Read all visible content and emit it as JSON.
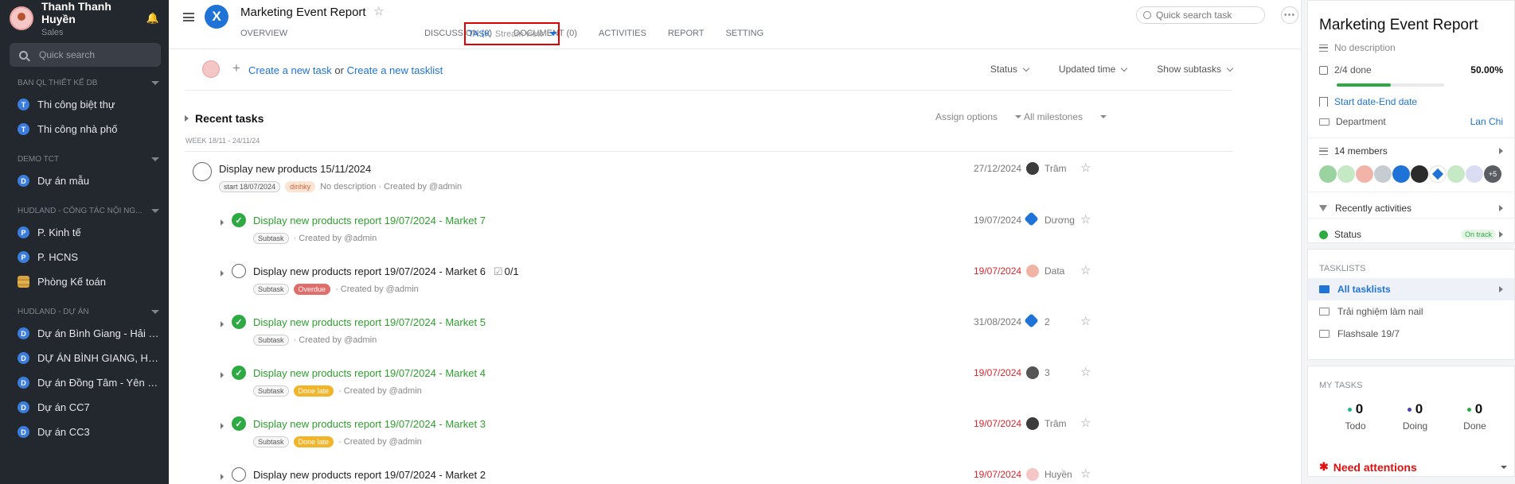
{
  "user": {
    "name": "Thanh Thanh Huyền",
    "role": "Sales"
  },
  "sidebar": {
    "search_placeholder": "Quick search",
    "groups": [
      {
        "title": "BAN QL THIẾT KẾ DB",
        "items": [
          {
            "badge": "T",
            "label": "Thi công biệt thự"
          },
          {
            "badge": "T",
            "label": "Thi công nhà phố"
          }
        ]
      },
      {
        "title": "DEMO TCT",
        "items": [
          {
            "badge": "D",
            "label": "Dự án mẫu"
          }
        ]
      },
      {
        "title": "HUDLAND - CÔNG TÁC NỘI NG...",
        "items": [
          {
            "badge": "P",
            "label": "P. Kinh tế"
          },
          {
            "badge": "P",
            "label": "P. HCNS"
          },
          {
            "badge": "",
            "label": "Phòng Kế toán"
          }
        ]
      },
      {
        "title": "HUDLAND - DỰ ÁN",
        "items": [
          {
            "badge": "D",
            "label": "Dự án Bình Giang - Hải D..."
          },
          {
            "badge": "D",
            "label": "DỰ ÁN BÌNH GIANG, HẢI ..."
          },
          {
            "badge": "D",
            "label": "Dự án Đồng Tâm - Yên Bái"
          },
          {
            "badge": "D",
            "label": "Dự án CC7"
          },
          {
            "badge": "D",
            "label": "Dự án CC3"
          }
        ]
      }
    ]
  },
  "header": {
    "title": "Marketing Event Report",
    "logo_letter": "X",
    "tabs": {
      "overview": "OVERVIEW",
      "task": "TASK",
      "stream_view": "Stream view",
      "discussion": "DISCUSSION (0)",
      "document": "DOCUMENT (0)",
      "activities": "ACTIVITIES",
      "report": "REPORT",
      "setting": "SETTING"
    },
    "search_placeholder": "Quick search task"
  },
  "create": {
    "create_task": "Create a new task",
    "or": " or ",
    "create_tasklist": "Create a new tasklist"
  },
  "filters": {
    "status": "Status",
    "updated": "Updated time",
    "subtasks": "Show subtasks"
  },
  "section": {
    "title": "Recent tasks",
    "week": "WEEK 18/11 - 24/11/24",
    "assign": "Assign options",
    "milestones": "All milestones"
  },
  "tasks": [
    {
      "name": "Display new products 15/11/2024",
      "start": "start 18/07/2024",
      "tag": "dinhky",
      "meta": "No description · Created by @admin",
      "date": "27/12/2024",
      "assignee": "Trâm"
    },
    {
      "name": "Display new products report 19/07/2024 - Market 7",
      "pill": "Subtask",
      "meta": "· Created by @admin",
      "date": "19/07/2024",
      "assignee": "Dương"
    },
    {
      "name": "Display new products report 19/07/2024 - Market 6",
      "sub": "0/1",
      "pill": "Subtask",
      "status": "Overdue",
      "meta": "· Created by @admin",
      "date": "19/07/2024",
      "assignee": "Data"
    },
    {
      "name": "Display new products report 19/07/2024 - Market 5",
      "pill": "Subtask",
      "meta": "· Created by @admin",
      "date": "31/08/2024",
      "assignee": "2"
    },
    {
      "name": "Display new products report 19/07/2024 - Market 4",
      "pill": "Subtask",
      "status": "Done late",
      "meta": "· Created by @admin",
      "date": "19/07/2024",
      "assignee": "3"
    },
    {
      "name": "Display new products report 19/07/2024 - Market 3",
      "pill": "Subtask",
      "status": "Done late",
      "meta": "· Created by @admin",
      "date": "19/07/2024",
      "assignee": "Trâm"
    },
    {
      "name": "Display new products report 19/07/2024 - Market 2",
      "date": "19/07/2024",
      "assignee": "Huyền"
    }
  ],
  "panel": {
    "title": "Marketing Event Report",
    "description": "No description",
    "done": "2/4 done",
    "percent": "50.00%",
    "progress": 0.5,
    "start_date": "Start date",
    "sep": " - ",
    "end_date": "End date",
    "department_label": "Department",
    "department_value": "Lan Chi",
    "members": "14 members",
    "more_members": "+5",
    "recently": "Recently activities",
    "status_label": "Status",
    "status_value": "On track"
  },
  "tasklists": {
    "title": "TASKLISTS",
    "items": [
      "All tasklists",
      "Trải nghiệm làm nail",
      "Flashsale 19/7"
    ]
  },
  "mytasks": {
    "title": "MY TASKS",
    "todo": "0",
    "todo_label": "Todo",
    "doing": "0",
    "doing_label": "Doing",
    "done": "0",
    "done_label": "Done",
    "attention": "Need attentions"
  },
  "colors": {
    "accent": "#1f73d6",
    "success": "#2eaa44",
    "danger": "#d8262c",
    "sidebar_bg": "#23272e"
  }
}
